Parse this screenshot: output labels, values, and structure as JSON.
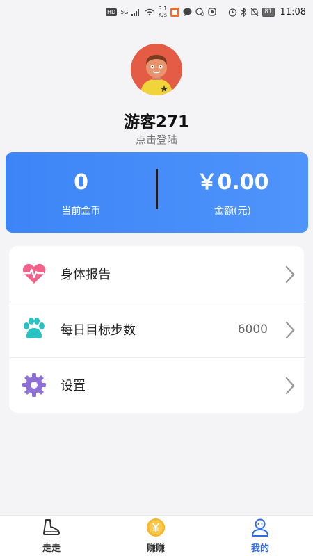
{
  "status_bar": {
    "hd": "HD",
    "network": "5G",
    "speed_value": "3.1",
    "speed_unit": "K/s",
    "battery": "81",
    "time": "11:08"
  },
  "profile": {
    "username": "游客271",
    "login_hint": "点击登陆"
  },
  "coin_card": {
    "coins_value": "0",
    "coins_label": "当前金币",
    "amount_value": "￥0.00",
    "amount_label": "金额(元)"
  },
  "menu": {
    "items": [
      {
        "label": "身体报告",
        "icon": "heartbeat-icon",
        "value": ""
      },
      {
        "label": "每日目标步数",
        "icon": "paw-icon",
        "value": "6000"
      },
      {
        "label": "设置",
        "icon": "gear-icon",
        "value": ""
      }
    ]
  },
  "bottom_nav": {
    "tabs": [
      {
        "label": "走走",
        "icon": "shoe-icon"
      },
      {
        "label": "赚赚",
        "icon": "yuan-coin-icon"
      },
      {
        "label": "我的",
        "icon": "user-icon",
        "active": true
      }
    ]
  },
  "colors": {
    "accent": "#3d85f7",
    "active_tab": "#2f6de6",
    "heart": "#f2628b",
    "paw": "#27c3c2",
    "gear": "#8e6fd8",
    "avatar_bg": "#e55c46",
    "coin": "#f7b52c"
  }
}
